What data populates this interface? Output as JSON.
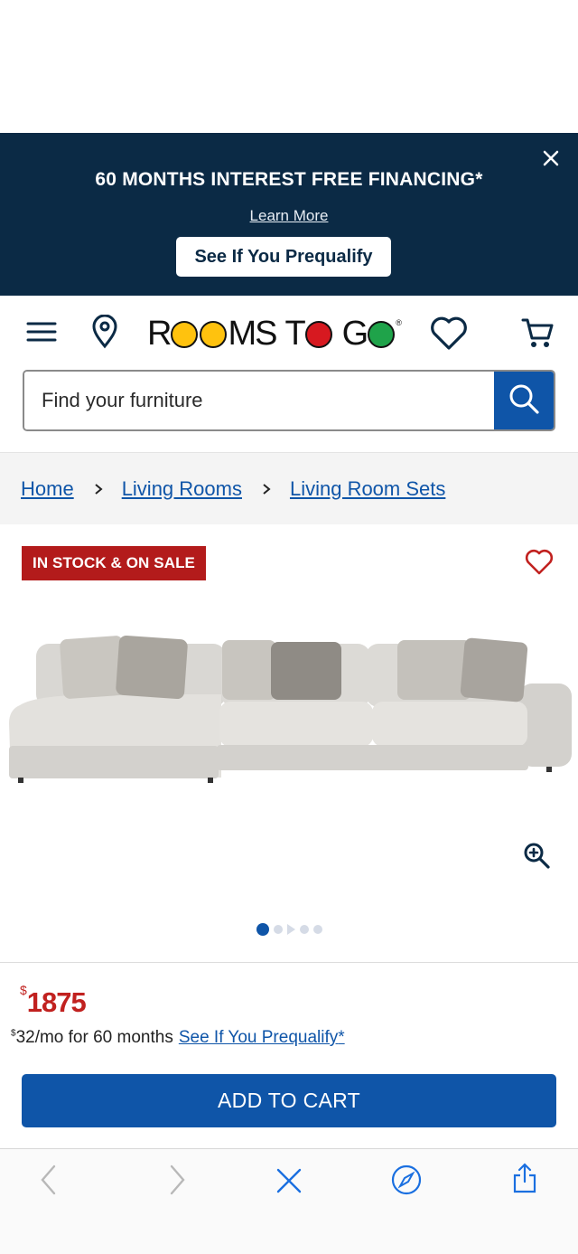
{
  "promo": {
    "title": "60 MONTHS INTEREST FREE FINANCING*",
    "link": "Learn More",
    "button": "See If You Prequalify",
    "bg_color": "#0b2a45",
    "close_icon": "close-icon"
  },
  "header": {
    "logo": "ROOMS TO GO",
    "logo_reg": "®",
    "icons": [
      "menu-icon",
      "location-pin-icon",
      "heart-icon",
      "cart-icon"
    ]
  },
  "search": {
    "placeholder": "Find your furniture",
    "value": ""
  },
  "breadcrumb": {
    "items": [
      "Home",
      "Living Rooms",
      "Living Room Sets"
    ],
    "separator": "›"
  },
  "product": {
    "badge": "IN STOCK & ON SALE",
    "image_alt": "Gray sectional sofa with chaise and patterned throw pillows",
    "gallery": {
      "total_dots": 5,
      "active_index": 0
    }
  },
  "pricing": {
    "currency_symbol": "$",
    "price": "1875",
    "monthly_symbol": "$",
    "monthly": "32/mo for 60 months",
    "prequalify_link": "See If You Prequalify",
    "prequalify_suffix": "*",
    "price_color": "#c1211f"
  },
  "cta": {
    "add_to_cart": "ADD TO CART",
    "color": "#0f55a8"
  },
  "browser_toolbar": {
    "icons": [
      "back-icon",
      "forward-icon",
      "close-icon",
      "compass-icon",
      "share-icon"
    ]
  }
}
